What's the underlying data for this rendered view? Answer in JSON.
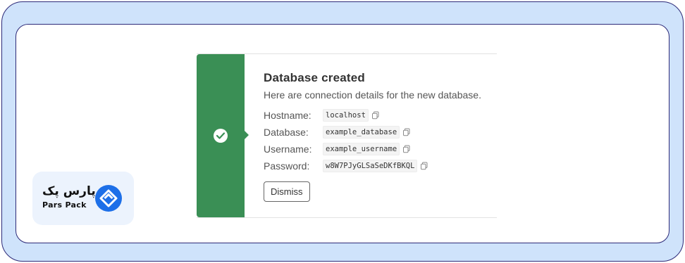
{
  "notice": {
    "title": "Database created",
    "description": "Here are connection details for the new database.",
    "status_color": "#3a8f55",
    "status_icon": "check-circle-icon",
    "details": [
      {
        "label": "Hostname:",
        "value": "localhost"
      },
      {
        "label": "Database:",
        "value": "example_database"
      },
      {
        "label": "Username:",
        "value": "example_username"
      },
      {
        "label": "Password:",
        "value": "w8W7PJyGLSaSeDKfBKQL"
      }
    ],
    "copy_icon": "copy-icon",
    "dismiss_label": "Dismiss"
  },
  "brand": {
    "name_fa": "پارس پک",
    "name_en": "Pars Pack",
    "logo_icon": "diamond-heart-logo-icon",
    "logo_color": "#1d6fe8"
  },
  "frame": {
    "background": "#cfe3fb",
    "border_color": "#2d2a78"
  }
}
